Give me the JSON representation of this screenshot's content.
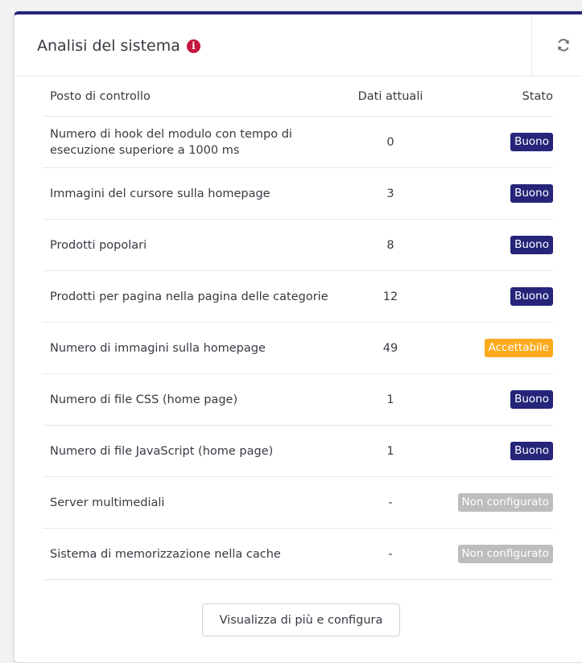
{
  "panel": {
    "title": "Analisi del sistema",
    "info_icon": "info-circle-icon",
    "refresh_icon": "refresh-icon"
  },
  "table": {
    "headers": {
      "checkpoint": "Posto di controllo",
      "current": "Dati attuali",
      "status": "Stato"
    },
    "rows": [
      {
        "label": "Numero di hook del modulo con tempo di esecuzione superiore a 1000 ms",
        "value": "0",
        "status": "Buono",
        "status_type": "good"
      },
      {
        "label": "Immagini del cursore sulla homepage",
        "value": "3",
        "status": "Buono",
        "status_type": "good"
      },
      {
        "label": "Prodotti popolari",
        "value": "8",
        "status": "Buono",
        "status_type": "good"
      },
      {
        "label": "Prodotti per pagina nella pagina delle categorie",
        "value": "12",
        "status": "Buono",
        "status_type": "good"
      },
      {
        "label": "Numero di immagini sulla homepage",
        "value": "49",
        "status": "Accettabile",
        "status_type": "acceptable"
      },
      {
        "label": "Numero di file CSS (home page)",
        "value": "1",
        "status": "Buono",
        "status_type": "good"
      },
      {
        "label": "Numero di file JavaScript (home page)",
        "value": "1",
        "status": "Buono",
        "status_type": "good"
      },
      {
        "label": "Server multimediali",
        "value": "-",
        "status": "Non configurato",
        "status_type": "off"
      },
      {
        "label": "Sistema di memorizzazione nella cache",
        "value": "-",
        "status": "Non configurato",
        "status_type": "off"
      }
    ]
  },
  "footer": {
    "button_label": "Visualizza di più e configura"
  },
  "colors": {
    "good": "#25257a",
    "acceptable": "#fbaa1e",
    "off": "#bdbdbd",
    "info": "#c3173f"
  }
}
